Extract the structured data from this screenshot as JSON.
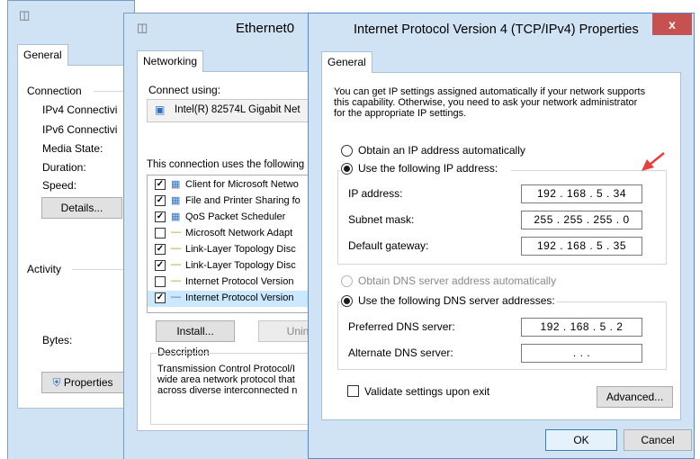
{
  "status_window": {
    "tab": "General",
    "connection_label": "Connection",
    "rows": [
      "IPv4 Connectivi",
      "IPv6 Connectivi",
      "Media State:",
      "Duration:",
      "Speed:"
    ],
    "details_button": "Details...",
    "activity_label": "Activity",
    "bytes_label": "Bytes:",
    "properties_button": "Properties"
  },
  "ethernet_window": {
    "title": "Ethernet0",
    "tab": "Networking",
    "connect_using_label": "Connect using:",
    "adapter_name": "Intel(R) 82574L Gigabit Net",
    "items_label": "This connection uses the following",
    "items": [
      {
        "checked": true,
        "label": "Client for Microsoft Netwo"
      },
      {
        "checked": true,
        "label": "File and Printer Sharing fo"
      },
      {
        "checked": true,
        "label": "QoS Packet Scheduler"
      },
      {
        "checked": false,
        "label": "Microsoft Network Adapt"
      },
      {
        "checked": true,
        "label": "Link-Layer Topology Disc"
      },
      {
        "checked": true,
        "label": "Link-Layer Topology Disc"
      },
      {
        "checked": false,
        "label": "Internet Protocol Version"
      },
      {
        "checked": true,
        "label": "Internet Protocol Version"
      }
    ],
    "install_button": "Install...",
    "uninstall_button": "Unin",
    "description_label": "Description",
    "description_lines": [
      "Transmission Control Protocol/I",
      "wide area network protocol that",
      "across diverse interconnected n"
    ]
  },
  "ipv4_dialog": {
    "title": "Internet Protocol Version 4 (TCP/IPv4) Properties",
    "close_glyph": "x",
    "tab": "General",
    "intro_lines": [
      "You can get IP settings assigned automatically if your network supports",
      "this capability. Otherwise, you need to ask your network administrator",
      "for the appropriate IP settings."
    ],
    "obtain_ip_auto": "Obtain an IP address automatically",
    "use_following_ip": "Use the following IP address:",
    "ip_address_label": "IP address:",
    "ip_address_value": "192 . 168 .  5  .  34",
    "subnet_mask_label": "Subnet mask:",
    "subnet_mask_value": "255 . 255 . 255 .  0",
    "default_gateway_label": "Default gateway:",
    "default_gateway_value": "192 . 168 .  5  .  35",
    "obtain_dns_auto": "Obtain DNS server address automatically",
    "use_following_dns": "Use the following DNS server addresses:",
    "preferred_dns_label": "Preferred DNS server:",
    "preferred_dns_value": "192 . 168 .  5  .  2",
    "alternate_dns_label": "Alternate DNS server:",
    "alternate_dns_value": ".       .       .",
    "validate_label": "Validate settings upon exit",
    "advanced_button": "Advanced...",
    "ok_button": "OK",
    "cancel_button": "Cancel"
  },
  "colors": {
    "window_frame": "#cfe3f5",
    "close_button": "#c75050",
    "annotation_arrow": "#e8403a"
  }
}
